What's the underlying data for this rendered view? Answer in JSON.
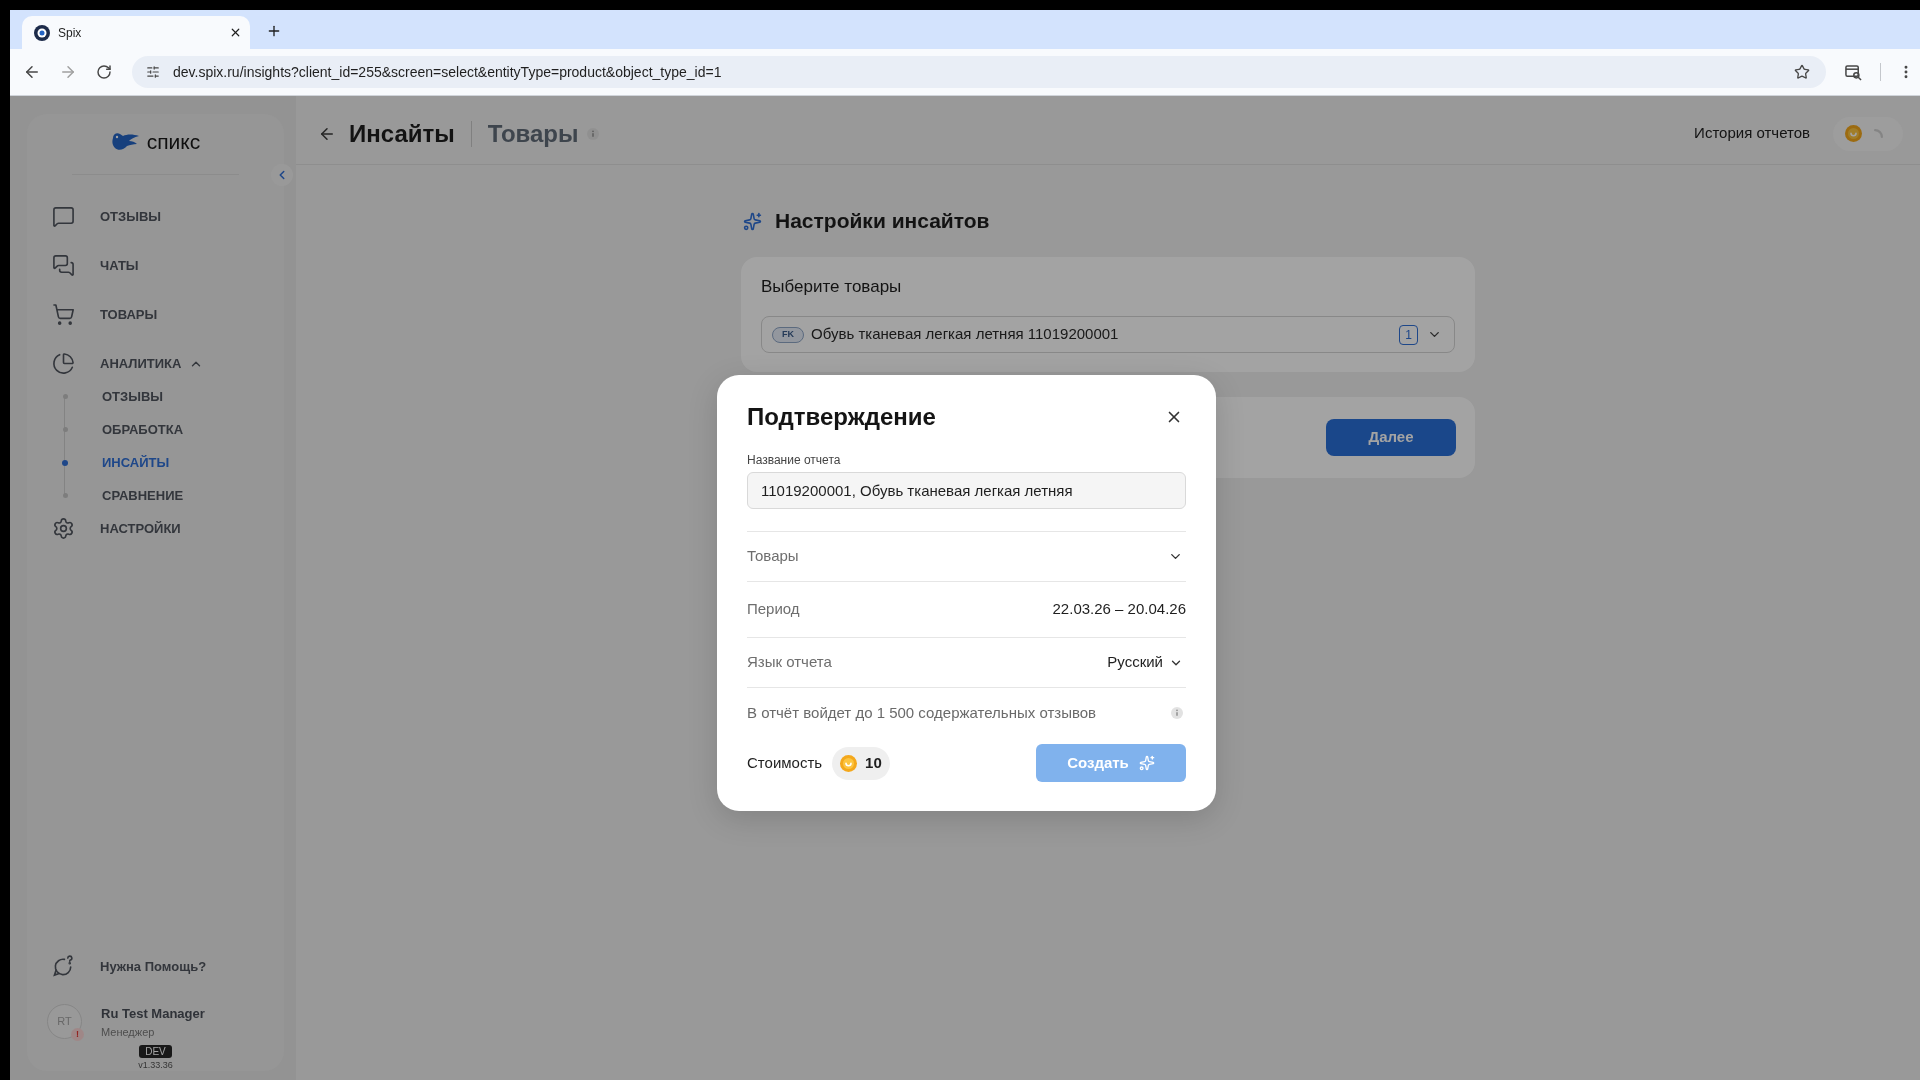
{
  "browser": {
    "tab": {
      "title": "Spix",
      "selected": true
    },
    "url": "dev.spix.ru/insights?client_id=255&screen=select&entityType=product&object_type_id=1"
  },
  "sidebar": {
    "logo": "спикс",
    "items": [
      {
        "label": "ОТЗЫВЫ",
        "selected": false
      },
      {
        "label": "ЧАТЫ",
        "selected": false
      },
      {
        "label": "ТОВАРЫ",
        "selected": false
      },
      {
        "label": "АНАЛИТИКА",
        "selected": false,
        "expanded": true,
        "children": [
          {
            "label": "ОТЗЫВЫ",
            "selected": false
          },
          {
            "label": "ОБРАБОТКА",
            "selected": false
          },
          {
            "label": "ИНСАЙТЫ",
            "selected": true
          },
          {
            "label": "СРАВНЕНИЕ",
            "selected": false
          }
        ]
      },
      {
        "label": "НАСТРОЙКИ",
        "selected": false
      }
    ],
    "help": "Нужна Помощь?",
    "user": {
      "initials": "RT",
      "alert": "!",
      "name": "Ru Test Manager",
      "role": "Менеджер"
    },
    "env_badge": "DEV",
    "version": "v1.33.36"
  },
  "header": {
    "title": "Инсайты",
    "subtitle": "Товары",
    "history_link": "История отчетов",
    "balance": {
      "loading": true
    }
  },
  "settings": {
    "title": "Настройки инсайтов",
    "products": {
      "label": "Выберите товары",
      "select": {
        "chip": "FK",
        "value": "Обувь тканевая легкая летняя 11019200001",
        "count": "1"
      }
    },
    "next_button": "Далее"
  },
  "modal": {
    "title": "Подтверждение",
    "name_field": {
      "label": "Название отчета",
      "value": "11019200001, Обувь тканевая легкая летняя"
    },
    "rows": [
      {
        "kind": "collapse",
        "label": "Товары",
        "expanded": false
      },
      {
        "kind": "value",
        "label": "Период",
        "value": "22.03.26 – 20.04.26"
      },
      {
        "kind": "select",
        "label": "Язык отчета",
        "value": "Русский"
      },
      {
        "kind": "note",
        "label": "В отчёт войдет до 1 500 содержательных отзывов"
      }
    ],
    "cost": {
      "label": "Стоимость",
      "amount": "10"
    },
    "create_button": {
      "label": "Создать",
      "disabled": true
    }
  }
}
